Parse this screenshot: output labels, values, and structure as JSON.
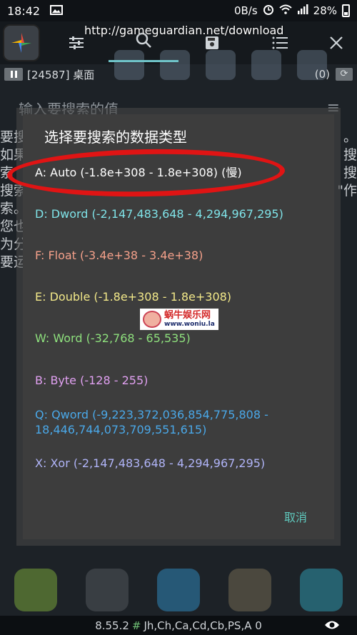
{
  "status_bar": {
    "time": "18:42",
    "speed": "0B/s",
    "battery": "28%"
  },
  "toolbar": {
    "url": "http://gameguardian.net/download"
  },
  "process": {
    "label": "[24587] 桌面",
    "count": "(0)"
  },
  "search": {
    "placeholder": "输入要搜索的值"
  },
  "background_text_left": [
    "要搜",
    "如果",
    "索",
    "搜索",
    "索。",
    "您也",
    "为分",
    "要运"
  ],
  "background_text_right": [
    "。",
    "搜",
    "",
    "搜",
    "",
    "\"作",
    "",
    ""
  ],
  "dialog": {
    "title": "选择要搜索的数据类型",
    "cancel_label": "取消",
    "options": [
      {
        "label": "A: Auto (-1.8e+308 - 1.8e+308) (慢)",
        "color": "#ffffff"
      },
      {
        "label": "D: Dword (-2,147,483,648 - 4,294,967,295)",
        "color": "#7fe3e8"
      },
      {
        "label": "F: Float (-3.4e+38 - 3.4e+38)",
        "color": "#f4a08a"
      },
      {
        "label": "E: Double (-1.8e+308 - 1.8e+308)",
        "color": "#f2e889"
      },
      {
        "label": "W: Word (-32,768 - 65,535)",
        "color": "#8ee07d"
      },
      {
        "label": "B: Byte (-128 - 255)",
        "color": "#e0a0f0"
      },
      {
        "label": "Q: Qword (-9,223,372,036,854,775,808 - 18,446,744,073,709,551,615)",
        "color": "#4aa8e8"
      },
      {
        "label": "X: Xor (-2,147,483,648 - 4,294,967,295)",
        "color": "#b0b4f8"
      }
    ]
  },
  "watermark": {
    "cn": "蜗牛娱乐网",
    "url": "www.woniu.la"
  },
  "footer": {
    "version": "8.55.2",
    "hash": "#",
    "flags": "Jh,Ch,Ca,Cd,Cb,PS,A 0"
  },
  "colors": {
    "dialog_bg": "#3d3d3d",
    "accent": "#5fc9bd",
    "highlight": "#e01414"
  }
}
